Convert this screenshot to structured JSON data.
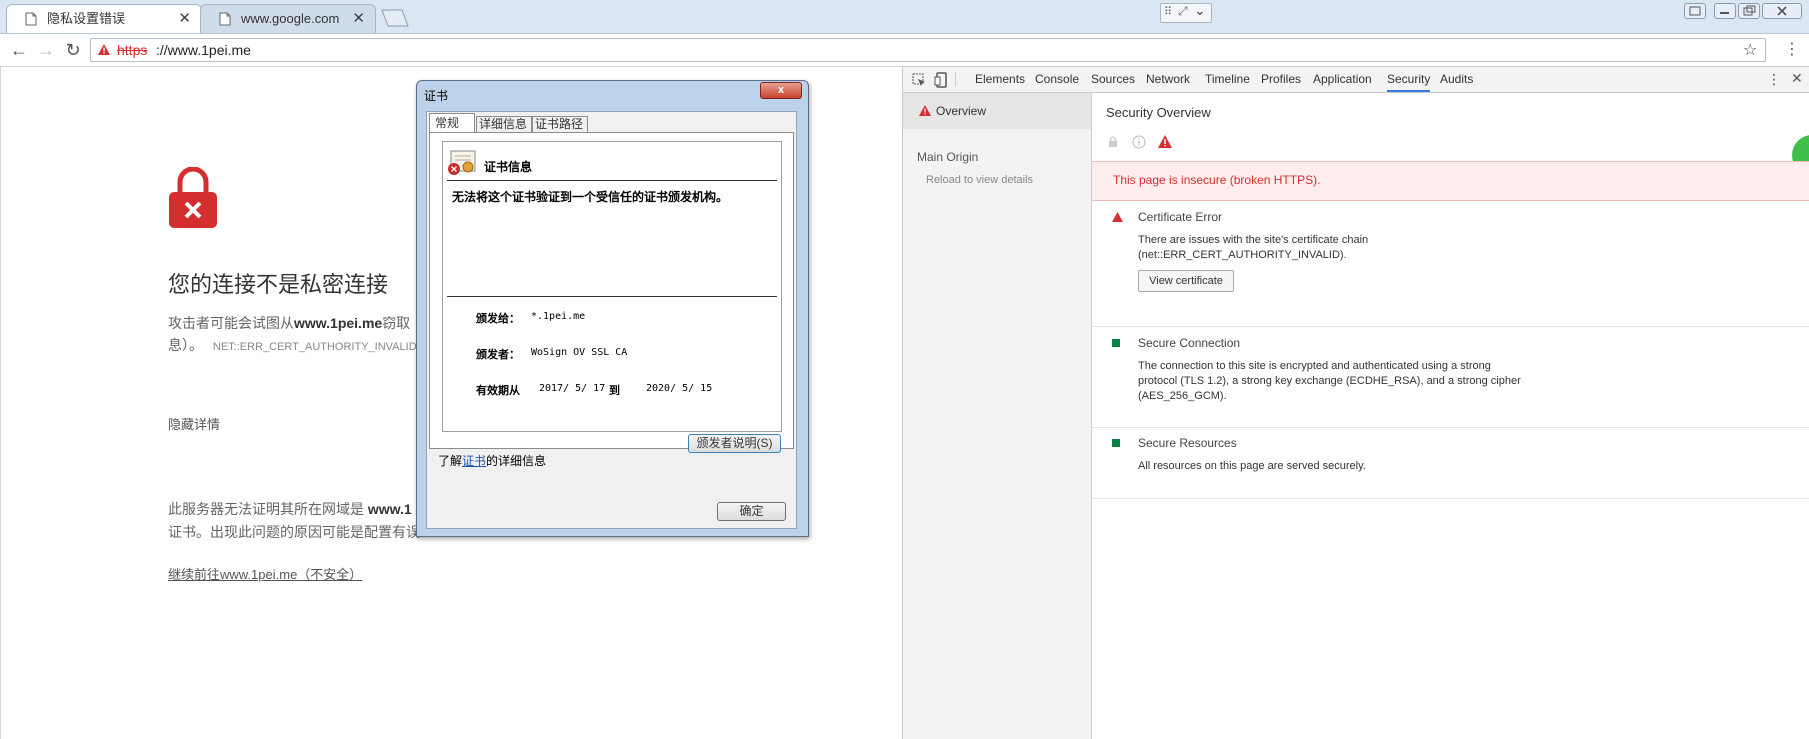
{
  "browser": {
    "tabs": [
      {
        "title": "隐私设置错误",
        "active": true
      },
      {
        "title": "www.google.com",
        "active": false
      }
    ],
    "address": {
      "scheme": "https",
      "rest": "://www.1pei.me"
    }
  },
  "page": {
    "heading": "您的连接不是私密连接",
    "warn_prefix": "攻击者可能会试图从",
    "warn_host": "www.1pei.me",
    "warn_suffix": "窃取",
    "warn_line2": "息）。",
    "error_code": "NET::ERR_CERT_AUTHORITY_INVALID",
    "hide_details": "隐藏详情",
    "detail_line1_prefix": "此服务器无法证明其所在网域是",
    "detail_line1_host": "www.1",
    "detail_line2": "证书。出现此问题的原因可能是配置有误",
    "proceed_link": "继续前往www.1pei.me（不安全）"
  },
  "dialog": {
    "title": "证书",
    "close": "x",
    "tabs": [
      "常规",
      "详细信息",
      "证书路径"
    ],
    "info_title": "证书信息",
    "message": "无法将这个证书验证到一个受信任的证书颁发机构。",
    "issued_to_label": "颁发给：",
    "issued_to": "*.1pei.me",
    "issued_by_label": "颁发者：",
    "issued_by": "WoSign OV SSL CA",
    "validity_label": "有效期从",
    "validity_from": "2017/ 5/ 17",
    "validity_to_word": "到",
    "validity_to": "2020/ 5/ 15",
    "issuer_statement_btn": "颁发者说明(S)",
    "learn_prefix": "了解",
    "learn_link": "证书",
    "learn_suffix": "的详细信息",
    "ok_btn": "确定"
  },
  "devtools": {
    "tabs": [
      "Elements",
      "Console",
      "Sources",
      "Network",
      "Timeline",
      "Profiles",
      "Application",
      "Security",
      "Audits"
    ],
    "active_tab": "Security",
    "sidebar": {
      "overview": "Overview",
      "main_origin": "Main Origin",
      "reload_hint": "Reload to view details"
    },
    "main": {
      "title": "Security Overview",
      "insecure_banner": "This page is insecure (broken HTTPS).",
      "sections": [
        {
          "title": "Certificate Error",
          "status": "error",
          "line1": "There are issues with the site's certificate chain",
          "line2": "(net::ERR_CERT_AUTHORITY_INVALID).",
          "line3": "",
          "button": "View certificate"
        },
        {
          "title": "Secure Connection",
          "status": "secure",
          "line1": "The connection to this site is encrypted and authenticated using a strong",
          "line2": "protocol (TLS 1.2), a strong key exchange (ECDHE_RSA), and a strong cipher",
          "line3": "(AES_256_GCM).",
          "button": ""
        },
        {
          "title": "Secure Resources",
          "status": "secure",
          "line1": "All resources on this page are served securely.",
          "line2": "",
          "line3": "",
          "button": ""
        }
      ]
    }
  },
  "colors": {
    "error_red": "#d32f2f",
    "secure_green": "#0b8043",
    "banner_bg": "#fdeded",
    "dialog_frame": "#bcd1ea",
    "link_blue": "#1a55b3"
  }
}
